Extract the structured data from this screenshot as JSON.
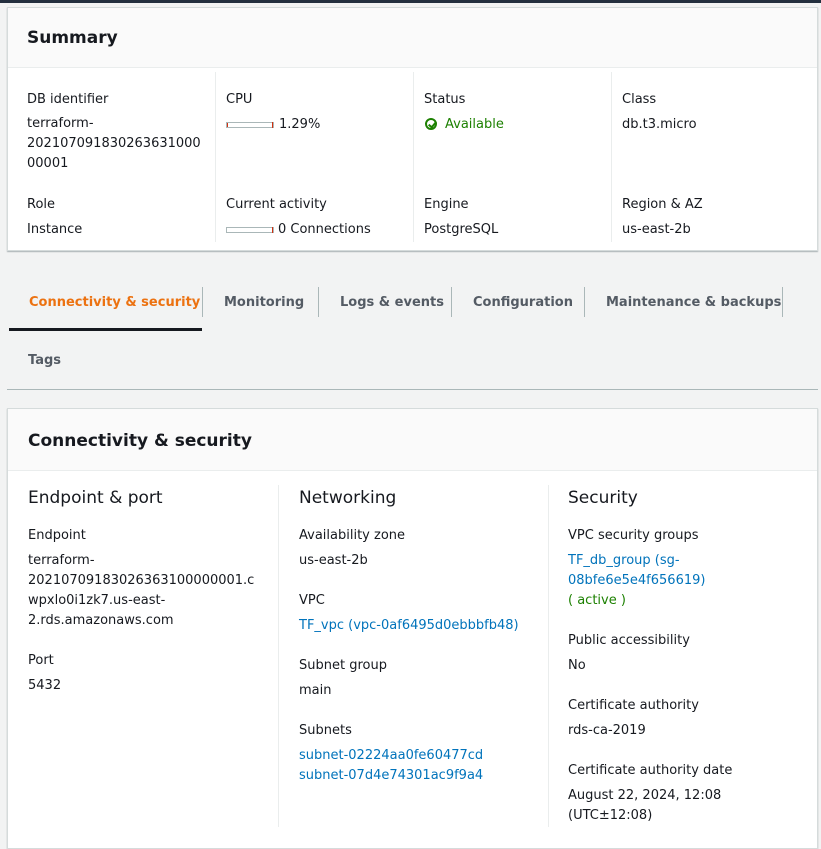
{
  "summary": {
    "title": "Summary",
    "db_identifier": {
      "label": "DB identifier",
      "lines": [
        "terraform-",
        "202107091830263631000",
        "00001"
      ]
    },
    "cpu": {
      "label": "CPU",
      "value": "1.29%",
      "fraction": 0.0129
    },
    "status": {
      "label": "Status",
      "value": "Available",
      "icon": "check-circle-icon",
      "color": "#1d8102"
    },
    "class": {
      "label": "Class",
      "value": "db.t3.micro"
    },
    "role": {
      "label": "Role",
      "value": "Instance"
    },
    "current_activity": {
      "label": "Current activity",
      "value": "0 Connections",
      "fraction": 0
    },
    "engine": {
      "label": "Engine",
      "value": "PostgreSQL"
    },
    "region": {
      "label": "Region & AZ",
      "value": "us-east-2b"
    }
  },
  "tabs": [
    {
      "label": "Connectivity & security",
      "active": true
    },
    {
      "label": "Monitoring"
    },
    {
      "label": "Logs & events"
    },
    {
      "label": "Configuration"
    },
    {
      "label": "Maintenance & backups"
    },
    {
      "label": "Tags"
    }
  ],
  "connectivity": {
    "title": "Connectivity & security",
    "endpoint_port": {
      "title": "Endpoint & port",
      "endpoint_label": "Endpoint",
      "endpoint_lines": [
        "terraform-",
        "20210709183026363100000001.c",
        "wpxlo0i1zk7.us-east-",
        "2.rds.amazonaws.com"
      ],
      "port_label": "Port",
      "port_value": "5432"
    },
    "networking": {
      "title": "Networking",
      "az_label": "Availability zone",
      "az_value": "us-east-2b",
      "vpc_label": "VPC",
      "vpc_value": "TF_vpc (vpc-0af6495d0ebbbfb48)",
      "subnet_group_label": "Subnet group",
      "subnet_group_value": "main",
      "subnets_label": "Subnets",
      "subnets": [
        "subnet-02224aa0fe60477cd",
        "subnet-07d4e74301ac9f9a4"
      ]
    },
    "security": {
      "title": "Security",
      "sg_label": "VPC security groups",
      "sg_lines": [
        "TF_db_group (sg-",
        "08bfe6e5e4f656619)"
      ],
      "sg_status": "( active )",
      "public_label": "Public accessibility",
      "public_value": "No",
      "ca_label": "Certificate authority",
      "ca_value": "rds-ca-2019",
      "ca_date_label": "Certificate authority date",
      "ca_date_lines": [
        "August 22, 2024, 12:08",
        "(UTC±12:08)"
      ]
    }
  },
  "colors": {
    "accent": "#ec7211",
    "link": "#0073bb",
    "success": "#1d8102",
    "meter": "#d13212"
  }
}
